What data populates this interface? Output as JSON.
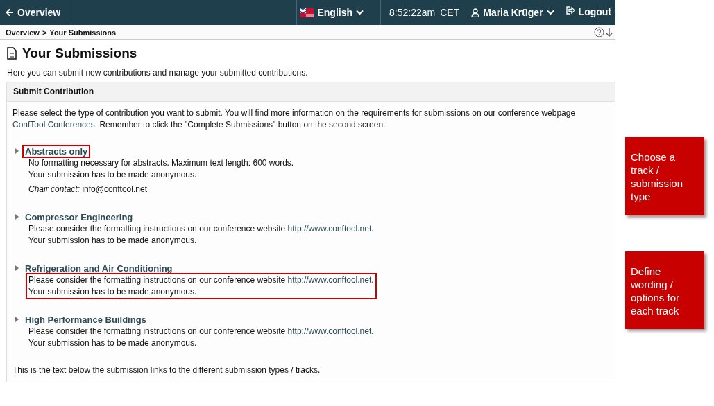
{
  "nav": {
    "back": "Overview",
    "language": "English",
    "time": "8:52:22am",
    "timezone": "CET",
    "user": "Maria Krüger",
    "logout": "Logout"
  },
  "breadcrumb": {
    "parent": "Overview",
    "separator": ">",
    "current": "Your Submissions"
  },
  "page": {
    "title": "Your Submissions",
    "intro": "Here you can submit new contributions and manage your submitted contributions."
  },
  "panel": {
    "title": "Submit Contribution",
    "text": "Please select the type of contribution you want to submit. You will find more information on the requirements for submissions on our conference webpage ",
    "link": "ConfTool Conferences",
    "tail": ". Remember to click the \"Complete Submissions\" button on the second screen.",
    "tracks": [
      {
        "title": "Abstracts only",
        "title_highlighted": true,
        "details_highlighted": false,
        "lines": [
          {
            "text": "No formatting necessary for abstracts. Maximum text length: 600 words."
          },
          {
            "text": "Your submission has to be made anonymous."
          }
        ],
        "contact": {
          "label": "Chair contact:",
          "value": "info@conftool.net"
        }
      },
      {
        "title": "Compressor Engineering",
        "title_highlighted": false,
        "details_highlighted": false,
        "lines": [
          {
            "text": "Please consider the formatting instructions on our conference website ",
            "link": "http://www.conftool.net",
            "tail": "."
          },
          {
            "text": "Your submission has to be made anonymous."
          }
        ]
      },
      {
        "title": "Refrigeration and Air Conditioning",
        "title_highlighted": false,
        "details_highlighted": true,
        "lines": [
          {
            "text": "Please consider the formatting instructions on our conference website ",
            "link": "http://www.conftool.net",
            "tail": "."
          },
          {
            "text": "Your submission has to be made anonymous."
          }
        ]
      },
      {
        "title": "High Performance Buildings",
        "title_highlighted": false,
        "details_highlighted": false,
        "lines": [
          {
            "text": "Please consider the formatting instructions on our conference website ",
            "link": "http://www.conftool.net",
            "tail": "."
          },
          {
            "text": "Your submission has to be made anonymous."
          }
        ]
      }
    ],
    "footer": "This is the text below the submission links to the different submission types / tracks."
  },
  "callouts": [
    "Choose a track / submission type",
    "Define wording / options for each track"
  ]
}
